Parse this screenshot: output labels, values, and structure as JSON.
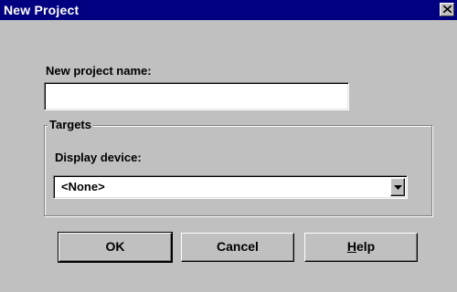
{
  "window": {
    "title": "New Project",
    "close_symbol": "close-icon"
  },
  "form": {
    "project_name_label": "New project name:",
    "project_name_value": "",
    "targets_group_label": "Targets",
    "display_device_label": "Display device:",
    "display_device_value": "<None>"
  },
  "buttons": {
    "ok_label": "OK",
    "cancel_label": "Cancel",
    "help_mnemonic": "H",
    "help_rest": "elp"
  },
  "colors": {
    "face": "#c0c0c0",
    "title_bar": "#000080",
    "title_text": "#ffffff"
  }
}
